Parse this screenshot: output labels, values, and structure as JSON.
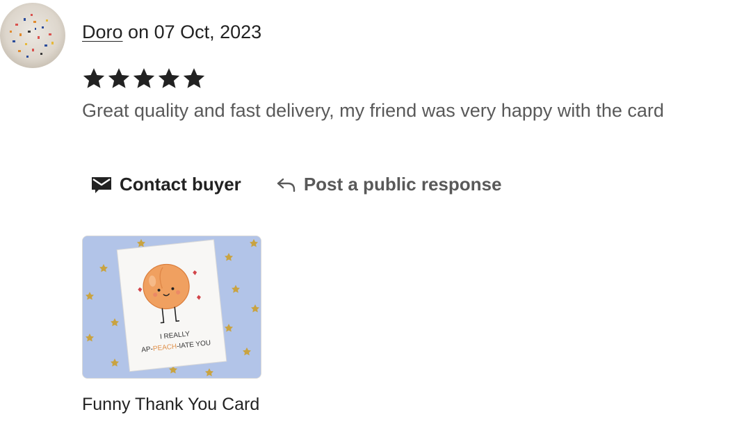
{
  "review": {
    "user_name": "Doro",
    "date_text": "on 07 Oct, 2023",
    "rating": 5,
    "text": "Great quality and fast delivery, my friend was very happy with the card"
  },
  "actions": {
    "contact_label": "Contact buyer",
    "respond_label": "Post a public response"
  },
  "listing": {
    "title": "Funny Thank You Card",
    "card_text_line1": "I REALLY",
    "card_text_pre": "AP-",
    "card_text_mid": "PEACH",
    "card_text_post": "-IATE YOU"
  }
}
